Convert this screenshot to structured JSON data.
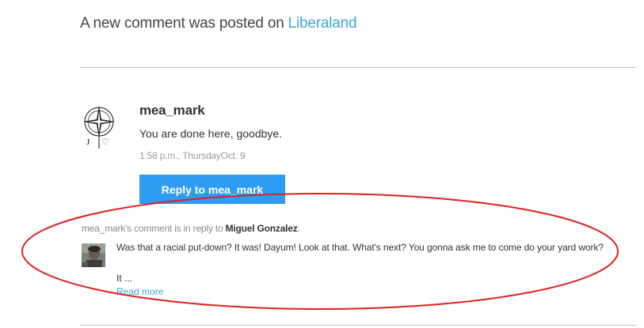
{
  "header": {
    "prefix": "A new comment was posted on",
    "site_name": "Liberaland"
  },
  "comment": {
    "author": "mea_mark",
    "avatar_icon": "compass-star-logo-icon",
    "avatar_letters": "J ♡",
    "body": "You are done here, goodbye.",
    "timestamp": "1:58 p.m., ThursdayOct. 9",
    "reply_label": "Reply to mea_mark"
  },
  "parent": {
    "intro": "mea_mark's comment is in reply to",
    "author": "Miguel Gonzalez",
    "suffix": ":",
    "text": "Was that a racial put-down? It was! Dayum! Look at that. What's next? You gonna ask me to come do your yard work?",
    "ellipsis": "It ...",
    "read_more": "Read more"
  },
  "colors": {
    "link": "#3ba7d6",
    "button": "#2e9cf2",
    "annotation": "#e02020"
  }
}
